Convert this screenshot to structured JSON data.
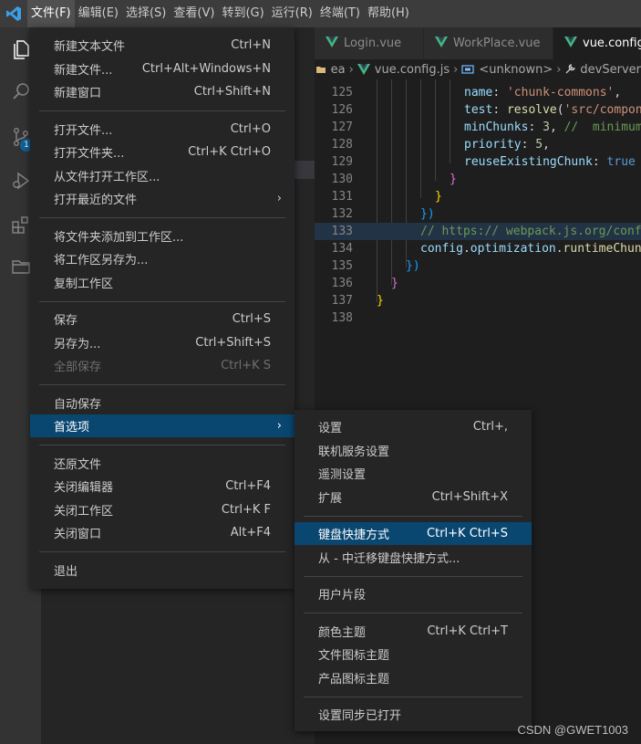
{
  "menubar": {
    "items": [
      "文件(F)",
      "编辑(E)",
      "选择(S)",
      "查看(V)",
      "转到(G)",
      "运行(R)",
      "终端(T)",
      "帮助(H)"
    ],
    "active_index": 0
  },
  "activitybar": {
    "icons": [
      "explorer-icon",
      "search-icon",
      "source-control-icon",
      "run-debug-icon",
      "extensions-icon",
      "remote-explorer-icon"
    ],
    "source_control_badge": "1"
  },
  "tabs": [
    {
      "label": "Login.vue",
      "active": false
    },
    {
      "label": "WorkPlace.vue",
      "active": false
    },
    {
      "label": "vue.config.js",
      "active": true
    }
  ],
  "breadcrumb": {
    "items": [
      "ea",
      "vue.config.js",
      "<unknown>",
      "devServer"
    ]
  },
  "editor": {
    "lines": [
      {
        "n": "125",
        "parts": [
          [
            "prop",
            "name"
          ],
          [
            "plain",
            ": "
          ],
          [
            "str",
            "'chunk-commons'"
          ],
          [
            "plain",
            ","
          ]
        ]
      },
      {
        "n": "126",
        "parts": [
          [
            "prop",
            "test"
          ],
          [
            "plain",
            ": "
          ],
          [
            "fn",
            "resolve"
          ],
          [
            "plain",
            "("
          ],
          [
            "str",
            "'src/compone"
          ]
        ]
      },
      {
        "n": "127",
        "parts": [
          [
            "prop",
            "minChunks"
          ],
          [
            "plain",
            ": "
          ],
          [
            "num",
            "3"
          ],
          [
            "plain",
            ", "
          ],
          [
            "com",
            "//  minimum"
          ]
        ]
      },
      {
        "n": "128",
        "parts": [
          [
            "prop",
            "priority"
          ],
          [
            "plain",
            ": "
          ],
          [
            "num",
            "5"
          ],
          [
            "plain",
            ","
          ]
        ]
      },
      {
        "n": "129",
        "parts": [
          [
            "prop",
            "reuseExistingChunk"
          ],
          [
            "plain",
            ": "
          ],
          [
            "kw",
            "true"
          ]
        ]
      },
      {
        "n": "130",
        "parts": [
          [
            "b2",
            "}"
          ]
        ]
      },
      {
        "n": "131",
        "parts": [
          [
            "b1",
            "}"
          ]
        ]
      },
      {
        "n": "132",
        "parts": [
          [
            "b3",
            "})"
          ]
        ]
      },
      {
        "n": "133",
        "parts": [
          [
            "com",
            "// https:// webpack.js.org/confi"
          ]
        ]
      },
      {
        "n": "134",
        "parts": [
          [
            "prop",
            "config"
          ],
          [
            "plain",
            "."
          ],
          [
            "prop",
            "optimization"
          ],
          [
            "plain",
            "."
          ],
          [
            "fn",
            "runtimeChunk"
          ]
        ]
      },
      {
        "n": "135",
        "parts": [
          [
            "b3",
            "})"
          ]
        ]
      },
      {
        "n": "136",
        "parts": [
          [
            "b2",
            "}"
          ]
        ]
      },
      {
        "n": "137",
        "parts": [
          [
            "b1",
            "}"
          ]
        ]
      },
      {
        "n": "138",
        "parts": []
      }
    ]
  },
  "file_menu": {
    "groups": [
      [
        {
          "label": "新建文本文件",
          "shortcut": "Ctrl+N"
        },
        {
          "label": "新建文件...",
          "shortcut": "Ctrl+Alt+Windows+N"
        },
        {
          "label": "新建窗口",
          "shortcut": "Ctrl+Shift+N"
        }
      ],
      [
        {
          "label": "打开文件...",
          "shortcut": "Ctrl+O"
        },
        {
          "label": "打开文件夹...",
          "shortcut": "Ctrl+K Ctrl+O"
        },
        {
          "label": "从文件打开工作区...",
          "shortcut": ""
        },
        {
          "label": "打开最近的文件",
          "shortcut": "",
          "submenu": true
        }
      ],
      [
        {
          "label": "将文件夹添加到工作区...",
          "shortcut": ""
        },
        {
          "label": "将工作区另存为...",
          "shortcut": ""
        },
        {
          "label": "复制工作区",
          "shortcut": ""
        }
      ],
      [
        {
          "label": "保存",
          "shortcut": "Ctrl+S"
        },
        {
          "label": "另存为...",
          "shortcut": "Ctrl+Shift+S"
        },
        {
          "label": "全部保存",
          "shortcut": "Ctrl+K S",
          "disabled": true
        }
      ],
      [
        {
          "label": "自动保存",
          "shortcut": ""
        },
        {
          "label": "首选项",
          "shortcut": "",
          "submenu": true,
          "active": true
        }
      ],
      [
        {
          "label": "还原文件",
          "shortcut": ""
        },
        {
          "label": "关闭编辑器",
          "shortcut": "Ctrl+F4"
        },
        {
          "label": "关闭工作区",
          "shortcut": "Ctrl+K F"
        },
        {
          "label": "关闭窗口",
          "shortcut": "Alt+F4"
        }
      ],
      [
        {
          "label": "退出",
          "shortcut": ""
        }
      ]
    ],
    "submenu_arrow": "›"
  },
  "preferences_menu": {
    "groups": [
      [
        {
          "label": "设置",
          "shortcut": "Ctrl+,"
        },
        {
          "label": "联机服务设置",
          "shortcut": ""
        },
        {
          "label": "遥测设置",
          "shortcut": ""
        },
        {
          "label": "扩展",
          "shortcut": "Ctrl+Shift+X"
        }
      ],
      [
        {
          "label": "键盘快捷方式",
          "shortcut": "Ctrl+K Ctrl+S",
          "active": true
        },
        {
          "label": "从 - 中迁移键盘快捷方式...",
          "shortcut": ""
        }
      ],
      [
        {
          "label": "用户片段",
          "shortcut": ""
        }
      ],
      [
        {
          "label": "颜色主题",
          "shortcut": "Ctrl+K Ctrl+T"
        },
        {
          "label": "文件图标主题",
          "shortcut": ""
        },
        {
          "label": "产品图标主题",
          "shortcut": ""
        }
      ],
      [
        {
          "label": "设置同步已打开",
          "shortcut": ""
        }
      ]
    ]
  },
  "watermark": "CSDN @GWET1003",
  "colors": {
    "accent": "#094771",
    "vue_green": "#41b883",
    "vscode_blue": "#3b9fe8"
  }
}
